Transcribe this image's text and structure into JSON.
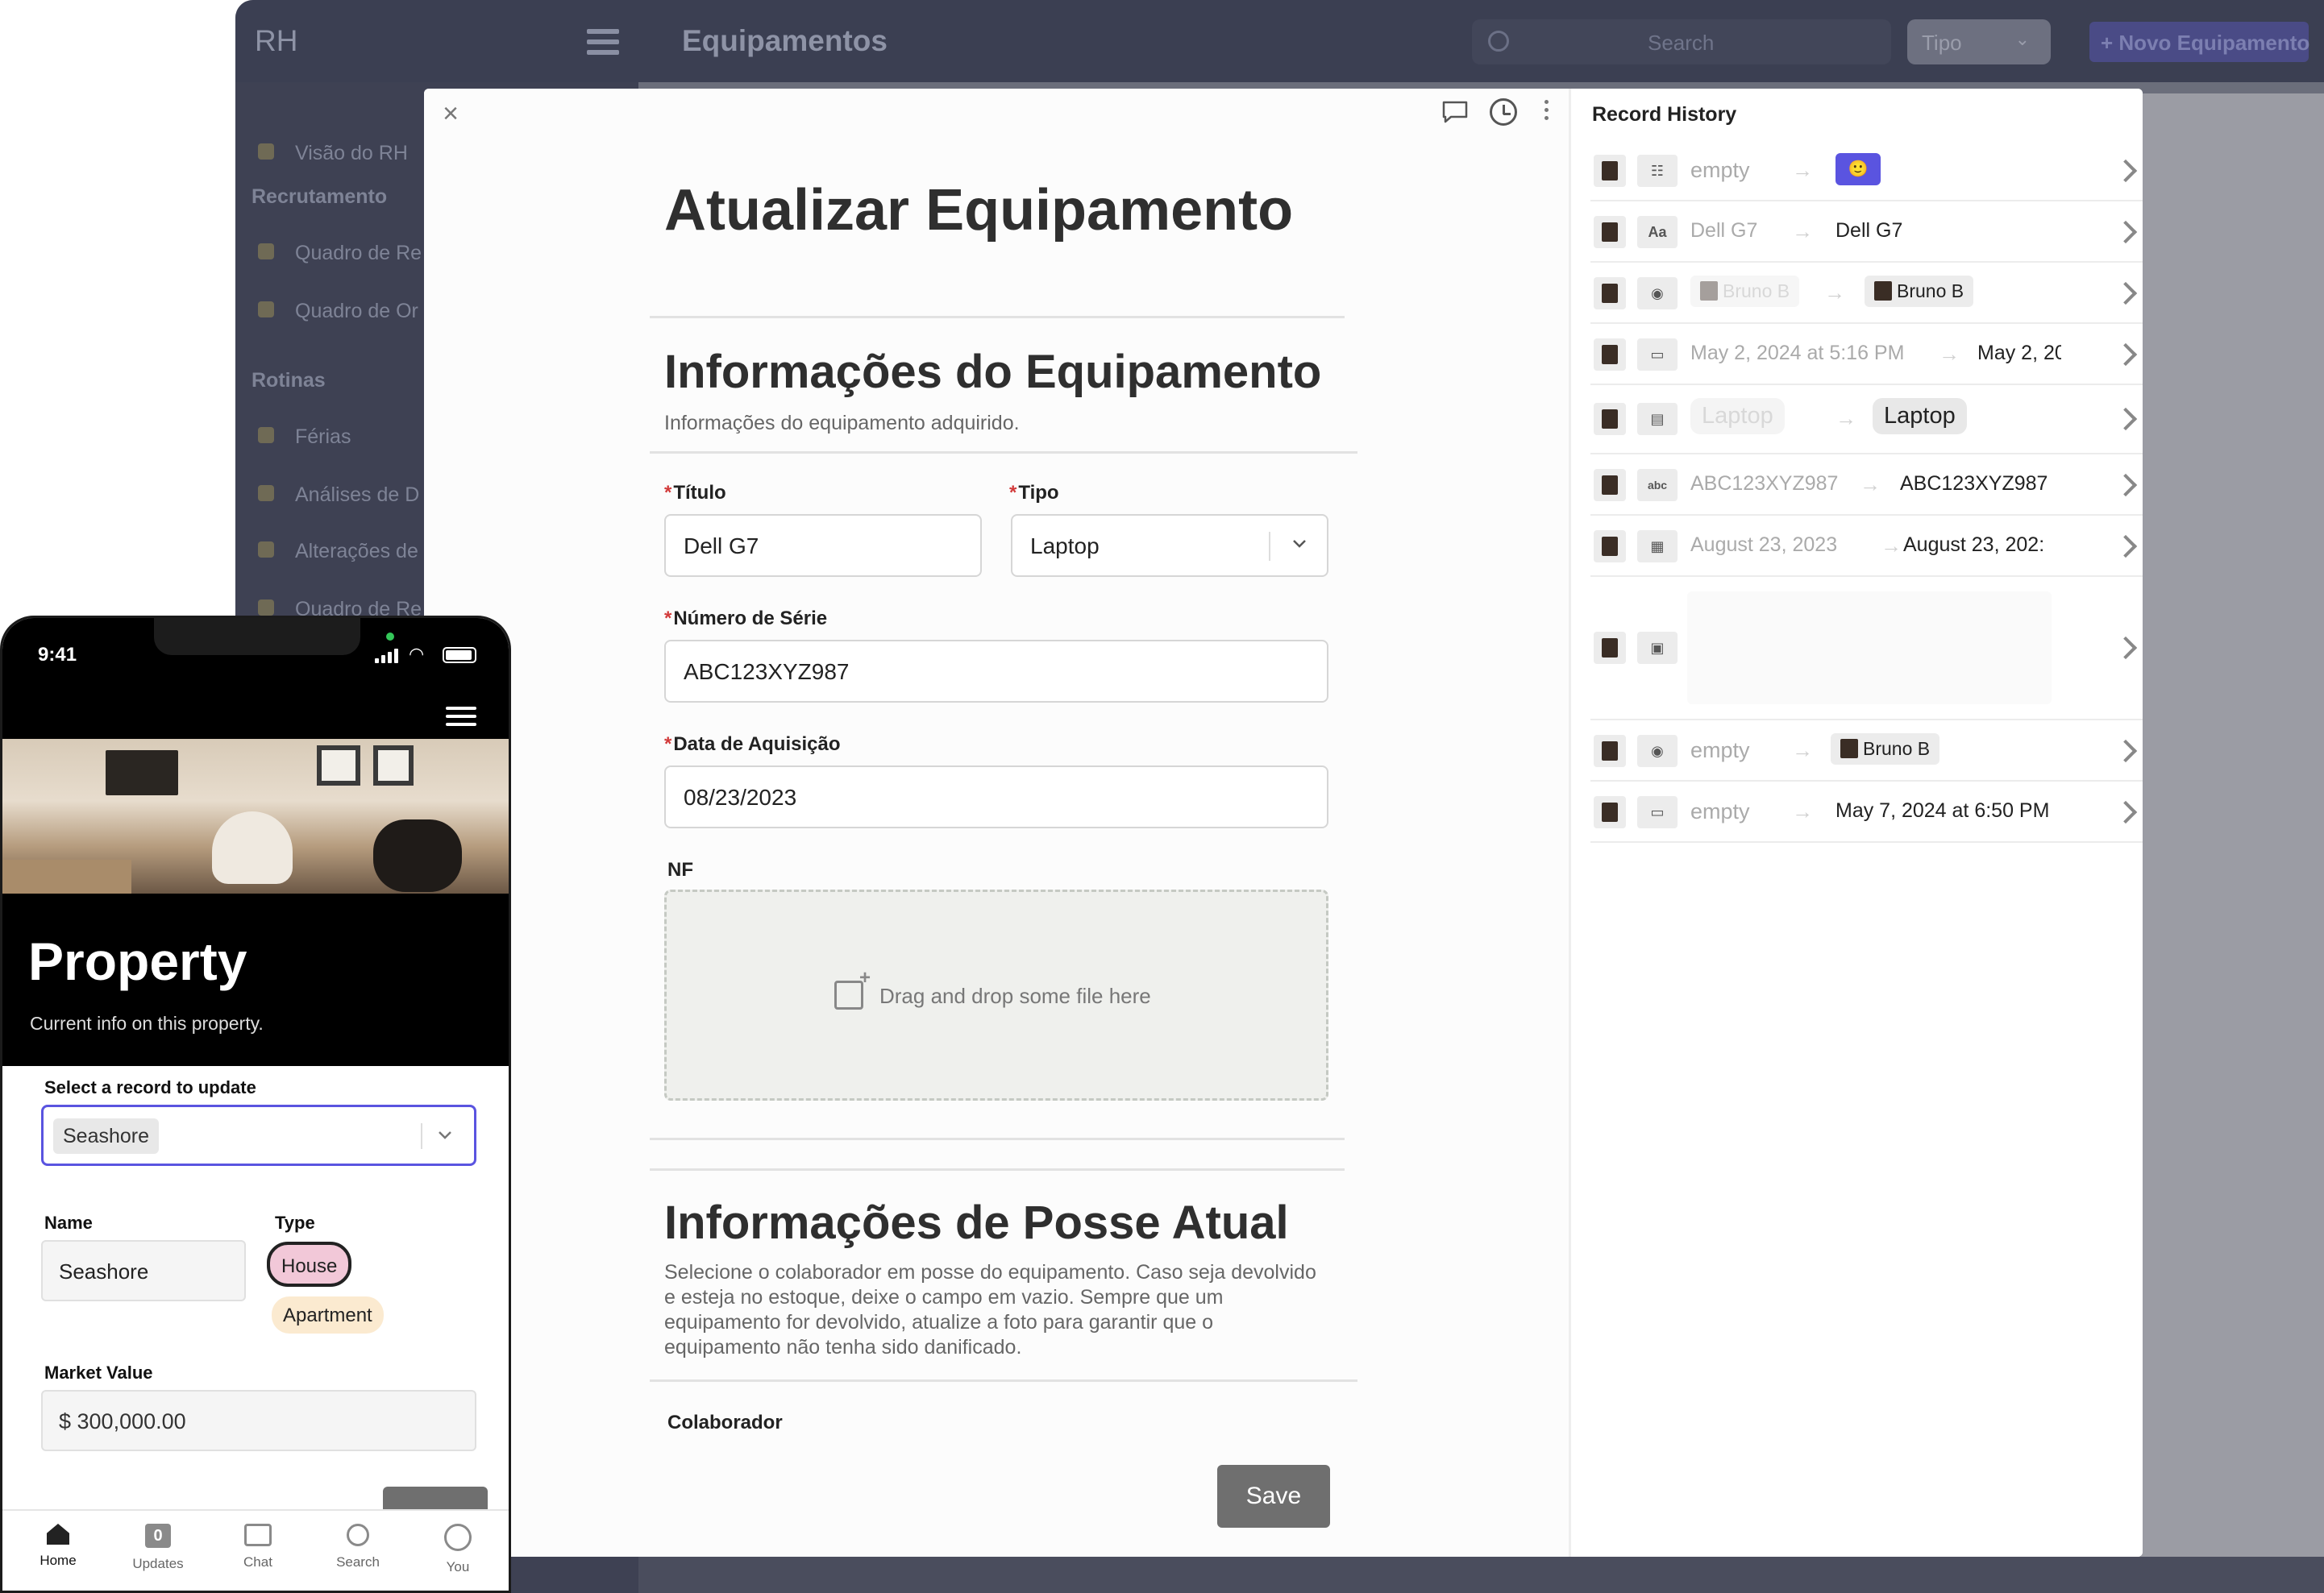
{
  "app": {
    "brand": "RH",
    "page_title": "Equipamentos",
    "search_placeholder": "Search",
    "type_filter": "Tipo",
    "new_button": "+ Novo Equipamento",
    "sidebar": {
      "item_overview": "Visão do RH",
      "section_recruitment": "Recrutamento",
      "item_board_re": "Quadro de Re",
      "item_board_or": "Quadro de Or",
      "section_routines": "Rotinas",
      "item_vacation": "Férias",
      "item_reviews": "Análises de D",
      "item_changes": "Alterações de",
      "item_board_re2": "Quadro de Re"
    }
  },
  "modal": {
    "title": "Atualizar Equipamento",
    "section1_title": "Informações do Equipamento",
    "section1_desc": "Informações do equipamento adquirido.",
    "field_title_label": "Título",
    "field_title_value": "Dell G7",
    "field_type_label": "Tipo",
    "field_type_value": "Laptop",
    "field_serial_label": "Número de Série",
    "field_serial_value": "ABC123XYZ987",
    "field_date_label": "Data de Aquisição",
    "field_date_value": "08/23/2023",
    "field_nf_label": "NF",
    "dropzone_text": "Drag and drop some file here",
    "section2_title": "Informações de Posse Atual",
    "section2_desc": "Selecione o colaborador em posse do equipamento. Caso seja devolvido e esteja no estoque, deixe o campo em vazio. Sempre que um equipamento for devolvido, atualize a foto para garantir que o equipamento não tenha sido danificado.",
    "field_collaborator_label": "Colaborador",
    "save_label": "Save",
    "required_mark": "*"
  },
  "history": {
    "title": "Record History",
    "rows": [
      {
        "field_icon": "status-icon",
        "old": "empty",
        "new": "",
        "emoji": "🙂"
      },
      {
        "field_icon": "text-icon",
        "field_glyph": "Aa",
        "old": "Dell G7",
        "new": "Dell G7"
      },
      {
        "field_icon": "person-icon",
        "old": "Bruno B",
        "new": "Bruno B"
      },
      {
        "field_icon": "datetime-icon",
        "old": "May 2, 2024 at 5:16 PM",
        "new": "May 2, 20"
      },
      {
        "field_icon": "select-icon",
        "old": "Laptop",
        "new": "Laptop"
      },
      {
        "field_icon": "abc-icon",
        "field_glyph": "abc",
        "old": "ABC123XYZ987",
        "new": "ABC123XYZ987"
      },
      {
        "field_icon": "calendar-icon",
        "old": "August 23, 2023",
        "new": "August 23, 202:"
      },
      {
        "field_icon": "image-icon",
        "old": "",
        "new": ""
      },
      {
        "field_icon": "person-icon",
        "old": "empty",
        "new": "Bruno B"
      },
      {
        "field_icon": "datetime-icon",
        "old": "empty",
        "new": "May 7, 2024 at 6:50 PM"
      }
    ]
  },
  "phone": {
    "time": "9:41",
    "title": "Property",
    "subtitle": "Current info on this property.",
    "select_label": "Select a record to update",
    "select_value": "Seashore",
    "name_label": "Name",
    "name_value": "Seashore",
    "type_label": "Type",
    "type_selected": "House",
    "type_other": "Apartment",
    "market_label": "Market Value",
    "market_value": "$ 300,000.00",
    "tabs": [
      {
        "label": "Home",
        "icon": "home-icon"
      },
      {
        "label": "Updates",
        "icon": "updates-icon",
        "badge": "0"
      },
      {
        "label": "Chat",
        "icon": "chat-icon"
      },
      {
        "label": "Search",
        "icon": "search-icon"
      },
      {
        "label": "You",
        "icon": "user-icon"
      }
    ]
  },
  "colors": {
    "accent": "#5a54e0",
    "app_header": "#3b3f52",
    "save_button": "#6f6f6f",
    "required": "#d23a3a"
  }
}
